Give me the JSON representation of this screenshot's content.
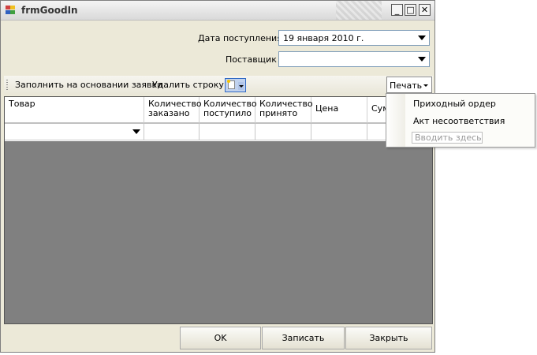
{
  "window": {
    "title": "frmGoodIn",
    "controls": {
      "minimize": "_",
      "maximize": "□",
      "close": "✕"
    }
  },
  "form": {
    "date_label": "Дата поступления",
    "date_value": "19   января   2010 г.",
    "supplier_label": "Поставщик",
    "supplier_value": ""
  },
  "toolbar": {
    "fill_from_request": "Заполнить на основании заявки",
    "delete_row": "Удалить строку",
    "print_label": "Печать"
  },
  "grid": {
    "columns": [
      {
        "label": "Товар"
      },
      {
        "label": "Количество\nзаказано"
      },
      {
        "label": "Количество\nпоступило"
      },
      {
        "label": "Количество\nпринято"
      },
      {
        "label": "Цена"
      },
      {
        "label": "Сум"
      }
    ]
  },
  "print_menu": {
    "items": [
      "Приходный ордер",
      "Акт несоответствия"
    ],
    "input_placeholder": "Вводить здесь"
  },
  "buttons": {
    "ok": "OK",
    "save": "Записать",
    "close": "Закрыть"
  }
}
